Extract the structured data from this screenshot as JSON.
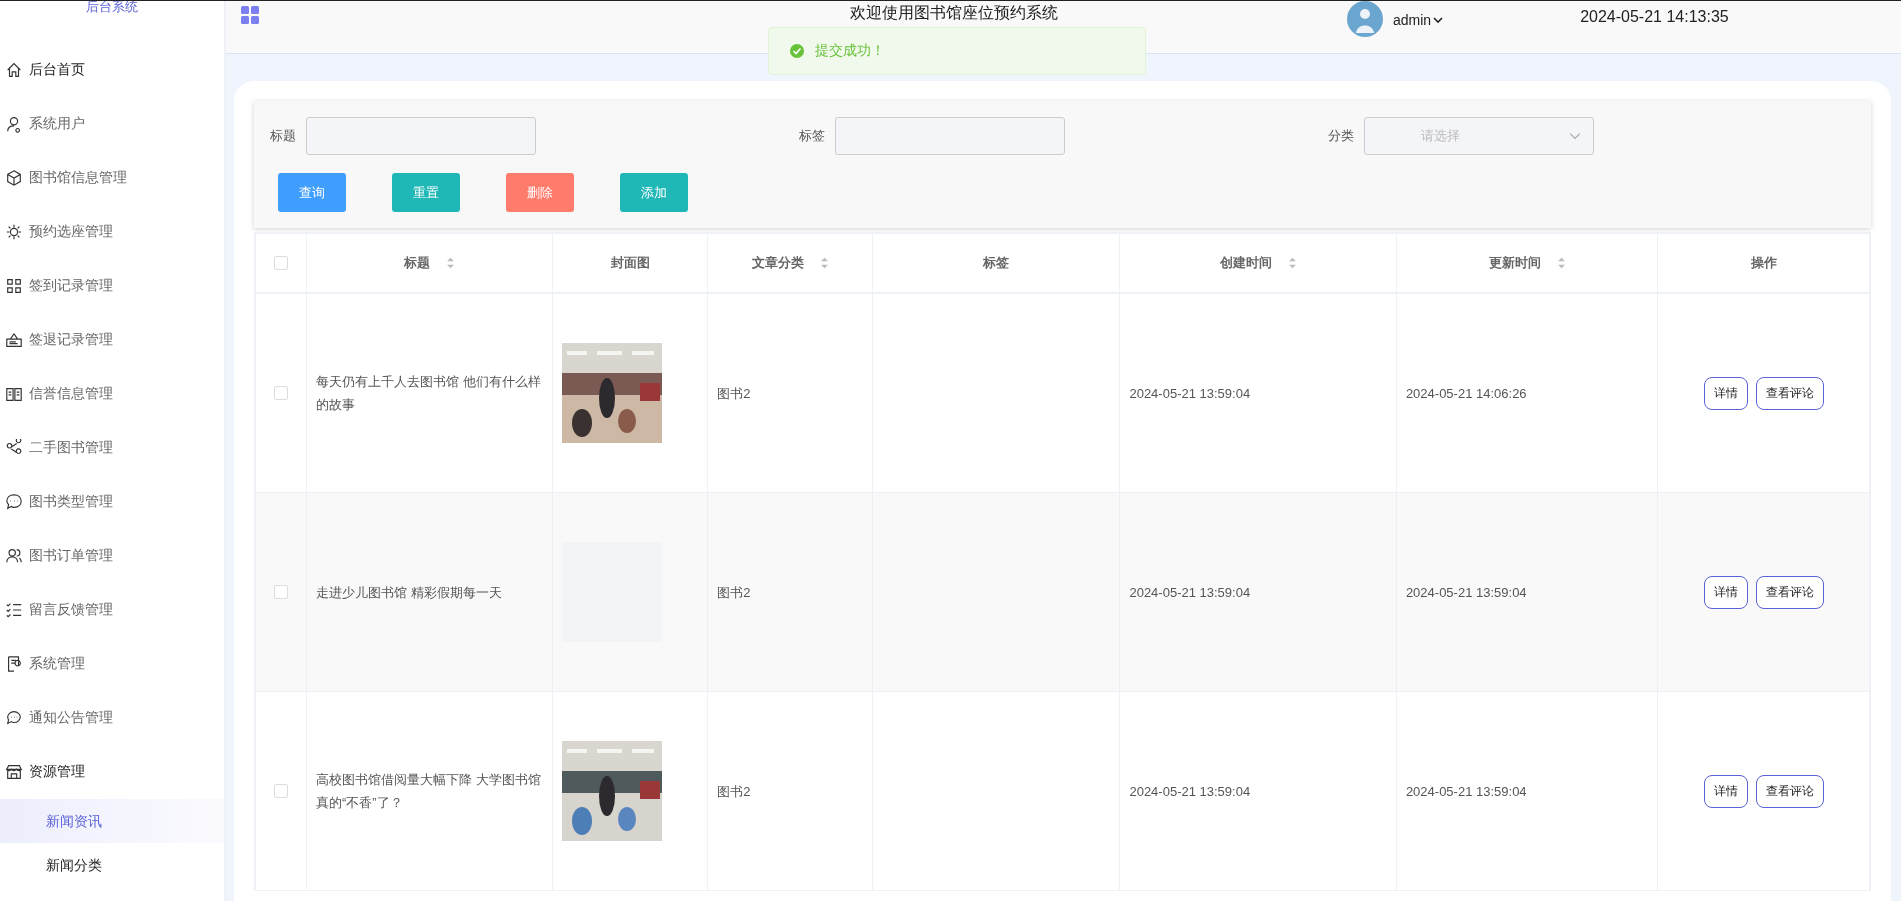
{
  "sidebar": {
    "title": "后台系统",
    "items": [
      {
        "label": "后台首页",
        "selected": true
      },
      {
        "label": "系统用户",
        "selected": false
      },
      {
        "label": "图书馆信息管理",
        "selected": false
      },
      {
        "label": "预约选座管理",
        "selected": false
      },
      {
        "label": "签到记录管理",
        "selected": false
      },
      {
        "label": "签退记录管理",
        "selected": false
      },
      {
        "label": "信誉信息管理",
        "selected": false
      },
      {
        "label": "二手图书管理",
        "selected": false
      },
      {
        "label": "图书类型管理",
        "selected": false
      },
      {
        "label": "图书订单管理",
        "selected": false
      },
      {
        "label": "留言反馈管理",
        "selected": false
      },
      {
        "label": "系统管理",
        "selected": false
      },
      {
        "label": "通知公告管理",
        "selected": false
      },
      {
        "label": "资源管理",
        "selected": true,
        "children": [
          {
            "label": "新闻资讯",
            "selected": true
          },
          {
            "label": "新闻分类",
            "selected": false
          }
        ]
      }
    ]
  },
  "header": {
    "title": "欢迎使用图书馆座位预约系统",
    "user": "admin",
    "datetime": "2024-05-21 14:13:35"
  },
  "toast": {
    "message": "提交成功！"
  },
  "filters": [
    {
      "label": "标题",
      "kind": "text"
    },
    {
      "label": "标签",
      "kind": "text"
    },
    {
      "label": "分类",
      "kind": "select",
      "placeholder": "请选择"
    }
  ],
  "buttons": [
    {
      "label": "查询",
      "color": "#409eff"
    },
    {
      "label": "重置",
      "color": "#20b7b7"
    },
    {
      "label": "删除",
      "color": "#ff7b6b"
    },
    {
      "label": "添加",
      "color": "#20b7b7"
    }
  ],
  "table": {
    "header_checked": false,
    "columns": [
      {
        "label": "标题",
        "sortable": true
      },
      {
        "label": "封面图",
        "sortable": false
      },
      {
        "label": "文章分类",
        "sortable": true
      },
      {
        "label": "标签",
        "sortable": false
      },
      {
        "label": "创建时间",
        "sortable": true
      },
      {
        "label": "更新时间",
        "sortable": true
      },
      {
        "label": "操作",
        "sortable": false
      }
    ],
    "rows": [
      {
        "checked": false,
        "title": "每天仍有上千人去图书馆 他们有什么样的故事",
        "cover": {
          "kind": "picture"
        },
        "category": "图书2",
        "created": "2024-05-21 13:59:04",
        "updated": "2024-05-21 14:06:26",
        "actions": [
          "详情",
          "查看评论"
        ]
      },
      {
        "checked": false,
        "title": "走进少儿图书馆 精彩假期每一天",
        "cover": {
          "kind": "placeholder"
        },
        "category": "图书2",
        "created": "2024-05-21 13:59:04",
        "updated": "2024-05-21 13:59:04",
        "actions": [
          "详情",
          "查看评论"
        ]
      },
      {
        "checked": false,
        "title": "高校图书馆借阅量大幅下降 大学图书馆真的“不香”了？",
        "cover": {
          "kind": "picture"
        },
        "category": "图书2",
        "created": "2024-05-21 13:59:04",
        "updated": "2024-05-21 13:59:04",
        "actions": [
          "详情",
          "查看评论"
        ]
      }
    ]
  }
}
